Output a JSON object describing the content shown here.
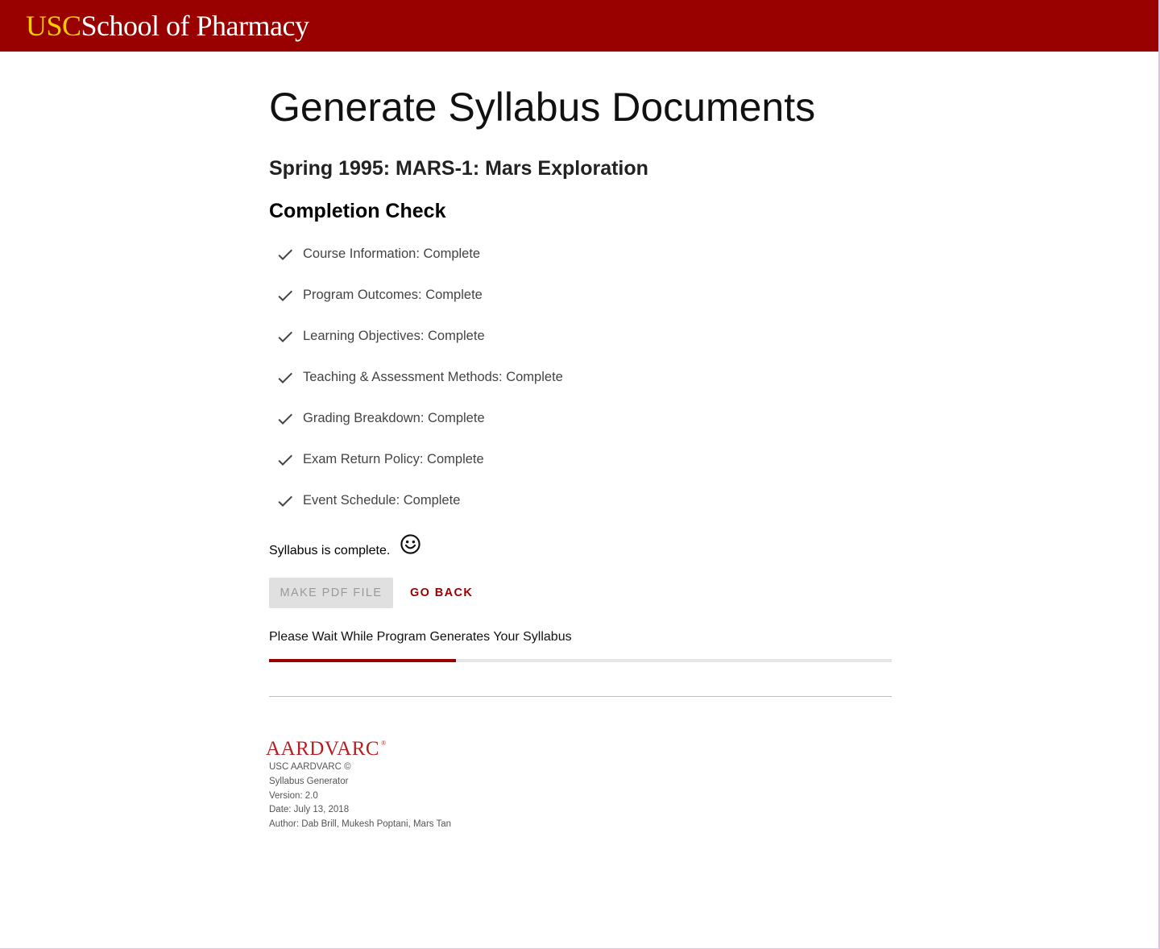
{
  "header": {
    "logo_usc": "USC",
    "logo_school": "School of Pharmacy",
    "bg_color": "#990000",
    "usc_color": "#FFCC00"
  },
  "page": {
    "title": "Generate Syllabus Documents",
    "course": "Spring 1995: MARS-1: Mars Exploration",
    "section_title": "Completion Check"
  },
  "checklist": [
    {
      "label": "Course Information: Complete",
      "icon": "check-icon"
    },
    {
      "label": "Program Outcomes: Complete",
      "icon": "check-icon"
    },
    {
      "label": "Learning Objectives: Complete",
      "icon": "check-icon"
    },
    {
      "label": "Teaching & Assessment Methods: Complete",
      "icon": "check-icon"
    },
    {
      "label": "Grading Breakdown: Complete",
      "icon": "check-icon"
    },
    {
      "label": "Exam Return Policy: Complete",
      "icon": "check-icon"
    },
    {
      "label": "Event Schedule: Complete",
      "icon": "check-icon"
    }
  ],
  "status": {
    "complete_text": "Syllabus is complete.",
    "icon": "smiley-icon"
  },
  "actions": {
    "make_pdf_label": "MAKE PDF FILE",
    "make_pdf_disabled": true,
    "go_back_label": "GO BACK"
  },
  "progress": {
    "message": "Please Wait While Program Generates Your Syllabus",
    "percent": 30,
    "color": "#990000"
  },
  "footer": {
    "logo_text": "AARDVARC",
    "logo_mark": "®",
    "lines": [
      "USC AARDVARC ©",
      "Syllabus Generator",
      "Version: 2.0",
      "Date: July 13, 2018",
      "Author: Dab Brill, Mukesh Poptani, Mars Tan"
    ]
  }
}
